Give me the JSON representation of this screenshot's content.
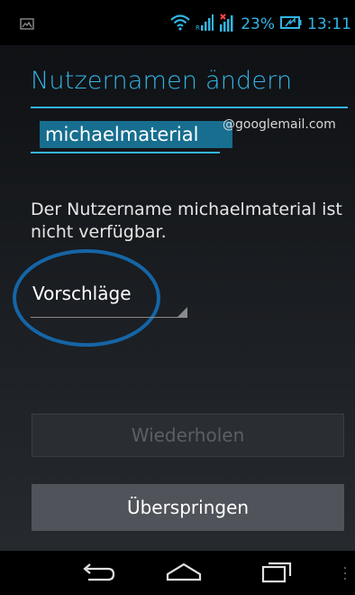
{
  "status_bar": {
    "battery": "23%",
    "time": "13:11",
    "colors": {
      "accent": "#33b5e5",
      "no_sim": "#ff4444"
    },
    "icons": [
      "image-notification-icon",
      "wifi-icon",
      "signal-icon",
      "no-sim-signal-icon",
      "battery-icon"
    ]
  },
  "page": {
    "title": "Nutzernamen ändern",
    "username": {
      "value": "michaelmaterial",
      "domain": "@googlemail.com"
    },
    "message": "Der Nutzername michaelmaterial ist nicht verfügbar.",
    "suggestions_label": "Vorschläge",
    "highlight_color": "#1565a6",
    "buttons": {
      "retry": "Wiederholen",
      "skip": "Überspringen"
    }
  },
  "nav_bar": {
    "icons": [
      "back-icon",
      "home-icon",
      "recent-apps-icon",
      "overflow-menu-icon"
    ]
  }
}
